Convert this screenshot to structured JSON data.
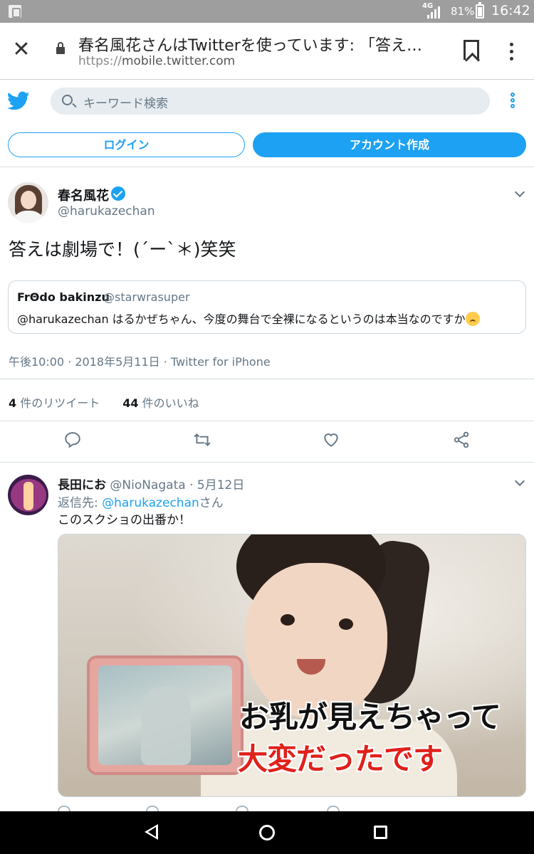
{
  "status_bar": {
    "network": "4G",
    "battery_percent": "81%",
    "battery_level": 0.81,
    "time": "16:42"
  },
  "browser": {
    "close_icon": "close-icon",
    "title": "春名風花さんはTwitterを使っています: 「答え…",
    "url_scheme": "https://",
    "url_host": "mobile.twitter.com"
  },
  "twitter_header": {
    "logo": "twitter-bird-icon",
    "search_placeholder": "キーワード検索",
    "login_label": "ログイン",
    "signup_label": "アカウント作成",
    "brand_color": "#1da1f2"
  },
  "tweet": {
    "author_name": "春名風花",
    "author_handle": "@harukazechan",
    "verified": true,
    "text": "答えは劇場で！(´ー`＊)笑笑",
    "quoted": {
      "author_name": "FrΘdo bakinzu",
      "author_handle": "@starwrasuper",
      "text": "@harukazechan はるかぜちゃん、今度の舞台で全裸になるというのは本当なのですか"
    },
    "timestamp": "午後10:00 · 2018年5月11日 · Twitter for iPhone",
    "retweets_count": "4",
    "retweets_label": "件のリツイート",
    "likes_count": "44",
    "likes_label": "件のいいね"
  },
  "reply": {
    "author_name": "長田にお",
    "author_handle": "@NioNagata",
    "date": "· 5月12日",
    "reply_to_prefix": "返信先: ",
    "reply_to_handle": "@harukazechan",
    "reply_to_suffix": "さん",
    "text": "このスクショの出番か！",
    "media_caption_line1": "お乳が見えちゃって",
    "media_caption_line2": "大変だったです"
  }
}
